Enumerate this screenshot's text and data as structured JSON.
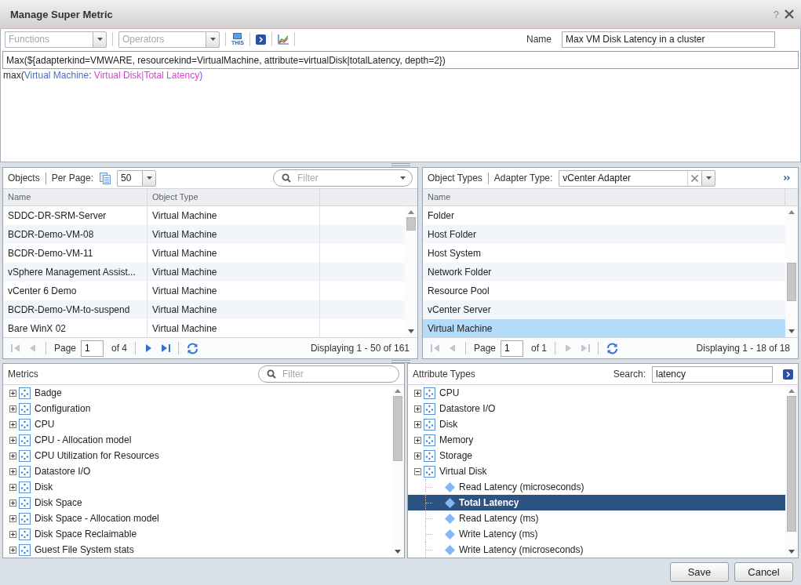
{
  "window": {
    "title": "Manage Super Metric",
    "help": "?"
  },
  "toolbar": {
    "functions": {
      "placeholder": "Functions"
    },
    "operators": {
      "placeholder": "Operators"
    },
    "this_button": {
      "label": "THIS"
    },
    "name": {
      "label": "Name",
      "value": "Max VM Disk Latency in a cluster"
    }
  },
  "formula": {
    "value": "Max(${adapterkind=VMWARE, resourcekind=VirtualMachine, attribute=virtualDisk|totalLatency, depth=2})",
    "preview": [
      {
        "kind": "function",
        "text": "max("
      },
      {
        "kind": "object",
        "text": "Virtual Machine"
      },
      {
        "kind": "separator",
        "text": ": "
      },
      {
        "kind": "attribute",
        "text": "Virtual Disk|Total Latency"
      },
      {
        "kind": "bracket",
        "text": ")"
      }
    ]
  },
  "objects": {
    "title": "Objects",
    "per_page_label": "Per Page:",
    "per_page": "50",
    "filter": {
      "placeholder": "Filter"
    },
    "columns": [
      "Name",
      "Object Type"
    ],
    "rows": [
      {
        "name": "SDDC-DR-SRM-Server",
        "type": "Virtual Machine",
        "selected": false
      },
      {
        "name": "BCDR-Demo-VM-08",
        "type": "Virtual Machine",
        "selected": false
      },
      {
        "name": "BCDR-Demo-VM-11",
        "type": "Virtual Machine",
        "selected": false
      },
      {
        "name": "vSphere Management Assist...",
        "type": "Virtual Machine",
        "selected": false
      },
      {
        "name": "vCenter 6 Demo",
        "type": "Virtual Machine",
        "selected": false
      },
      {
        "name": "BCDR-Demo-VM-to-suspend",
        "type": "Virtual Machine",
        "selected": false
      },
      {
        "name": "Bare WinX 02",
        "type": "Virtual Machine",
        "selected": false
      }
    ],
    "pager": {
      "nav_back": [
        {
          "kind": "first",
          "disabled": true
        },
        {
          "kind": "previous",
          "disabled": true
        }
      ],
      "page_label": "Page",
      "page": "1",
      "page_count": "of 4",
      "nav_forward": [
        {
          "kind": "next",
          "disabled": false
        },
        {
          "kind": "last",
          "disabled": false
        }
      ],
      "summary": "Displaying 1 - 50 of 161"
    }
  },
  "object_types": {
    "title": "Object Types",
    "adapter_label": "Adapter Type:",
    "adapter": "vCenter Adapter",
    "columns": [
      "Name"
    ],
    "rows": [
      {
        "name": "Folder",
        "selected": false
      },
      {
        "name": "Host Folder",
        "selected": false
      },
      {
        "name": "Host System",
        "selected": false
      },
      {
        "name": "Network Folder",
        "selected": false
      },
      {
        "name": "Resource Pool",
        "selected": false
      },
      {
        "name": "vCenter Server",
        "selected": false
      },
      {
        "name": "Virtual Machine",
        "selected": true
      }
    ],
    "pager": {
      "nav_back": [
        {
          "kind": "first",
          "disabled": true
        },
        {
          "kind": "previous",
          "disabled": true
        }
      ],
      "page_label": "Page",
      "page": "1",
      "page_count": "of 1",
      "nav_forward": [
        {
          "kind": "next",
          "disabled": true
        },
        {
          "kind": "last",
          "disabled": true
        }
      ],
      "summary": "Displaying 1 - 18 of 18"
    }
  },
  "metrics": {
    "title": "Metrics",
    "filter": {
      "placeholder": "Filter"
    },
    "tree": [
      {
        "kind": "group",
        "label": "Badge",
        "expanded": false,
        "selected": false
      },
      {
        "kind": "group",
        "label": "Configuration",
        "expanded": false,
        "selected": false
      },
      {
        "kind": "group",
        "label": "CPU",
        "expanded": false,
        "selected": false
      },
      {
        "kind": "group",
        "label": "CPU - Allocation model",
        "expanded": false,
        "selected": false
      },
      {
        "kind": "group",
        "label": "CPU Utilization for Resources",
        "expanded": false,
        "selected": false
      },
      {
        "kind": "group",
        "label": "Datastore I/O",
        "expanded": false,
        "selected": false
      },
      {
        "kind": "group",
        "label": "Disk",
        "expanded": false,
        "selected": false
      },
      {
        "kind": "group",
        "label": "Disk Space",
        "expanded": false,
        "selected": false
      },
      {
        "kind": "group",
        "label": "Disk Space - Allocation model",
        "expanded": false,
        "selected": false
      },
      {
        "kind": "group",
        "label": "Disk Space Reclaimable",
        "expanded": false,
        "selected": false
      },
      {
        "kind": "group",
        "label": "Guest File System stats",
        "expanded": false,
        "selected": false
      }
    ]
  },
  "attribute_types": {
    "title": "Attribute Types",
    "search_label": "Search:",
    "search": "latency",
    "tree": [
      {
        "kind": "group",
        "label": "CPU",
        "expanded": false,
        "selected": false
      },
      {
        "kind": "group",
        "label": "Datastore I/O",
        "expanded": false,
        "selected": false
      },
      {
        "kind": "group",
        "label": "Disk",
        "expanded": false,
        "selected": false
      },
      {
        "kind": "group",
        "label": "Memory",
        "expanded": false,
        "selected": false
      },
      {
        "kind": "group",
        "label": "Storage",
        "expanded": false,
        "selected": false
      },
      {
        "kind": "group",
        "label": "Virtual Disk",
        "expanded": true,
        "selected": false,
        "children": [
          {
            "kind": "metric",
            "label": "Read Latency (microseconds)",
            "selected": false
          },
          {
            "kind": "metric",
            "label": "Total Latency",
            "selected": true
          },
          {
            "kind": "metric",
            "label": "Read Latency (ms)",
            "selected": false
          },
          {
            "kind": "metric",
            "label": "Write Latency (ms)",
            "selected": false
          },
          {
            "kind": "metric",
            "label": "Write Latency (microseconds)",
            "selected": false
          }
        ]
      }
    ]
  },
  "footer": {
    "buttons": [
      {
        "label": "Save"
      },
      {
        "label": "Cancel"
      }
    ]
  }
}
